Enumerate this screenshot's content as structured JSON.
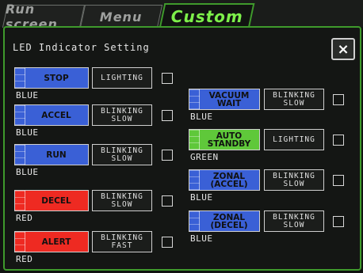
{
  "tabs": [
    {
      "label": "Run screen"
    },
    {
      "label": "Menu"
    },
    {
      "label": "Custom"
    }
  ],
  "title": "LED Indicator Setting",
  "close_label": "×",
  "colors": {
    "BLUE": "#3a60d6",
    "RED": "#ee2a22",
    "GREEN": "#5fc83a",
    "accent": "#3f9a2c"
  },
  "left_items": [
    {
      "label": "STOP",
      "mode": "LIGHTING",
      "color": "BLUE"
    },
    {
      "label": "ACCEL",
      "mode": "BLINKING\nSLOW",
      "color": "BLUE"
    },
    {
      "label": "RUN",
      "mode": "BLINKING\nSLOW",
      "color": "BLUE"
    },
    {
      "label": "DECEL",
      "mode": "BLINKING\nSLOW",
      "color": "RED"
    },
    {
      "label": "ALERT",
      "mode": "BLINKING\nFAST",
      "color": "RED"
    }
  ],
  "right_items": [
    {
      "label": "VACUUM\nWAIT",
      "mode": "BLINKING\nSLOW",
      "color": "BLUE"
    },
    {
      "label": "AUTO\nSTANDBY",
      "mode": "LIGHTING",
      "color": "GREEN"
    },
    {
      "label": "ZONAL\n(ACCEL)",
      "mode": "BLINKING\nSLOW",
      "color": "BLUE"
    },
    {
      "label": "ZONAL\n(DECEL)",
      "mode": "BLINKING\nSLOW",
      "color": "BLUE"
    }
  ]
}
